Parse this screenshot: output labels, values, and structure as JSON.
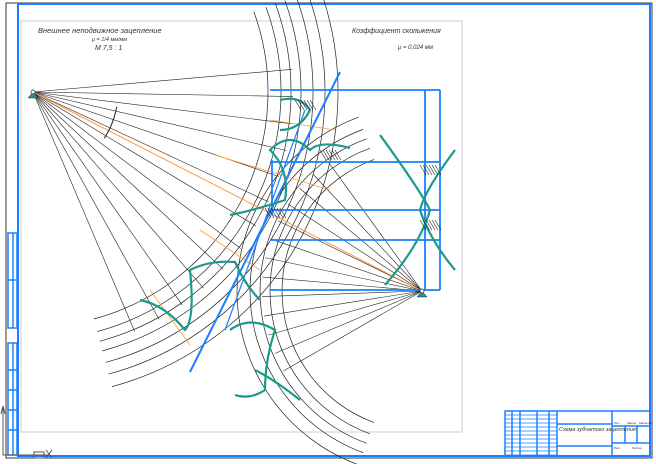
{
  "drawing": {
    "left_title": "Внешнее неподвижное зацепление",
    "left_scale_mu": "μ = 1/4 мм/мм",
    "left_scale": "М 7,5 : 1",
    "right_title": "Коэффициент скольжения",
    "right_scale": "μ = 0,024 мм"
  },
  "title_block": {
    "name": "Схема зубчатого зацепления",
    "col_labels": [
      "Лит.",
      "Масса",
      "Масштаб"
    ],
    "sheet": "Лист",
    "sheets": "Листов"
  },
  "colors": {
    "frame": "#1a7fff",
    "gear_profile": "#1a9a8a",
    "construction": "#ff9a3c",
    "lines": "#222222"
  }
}
